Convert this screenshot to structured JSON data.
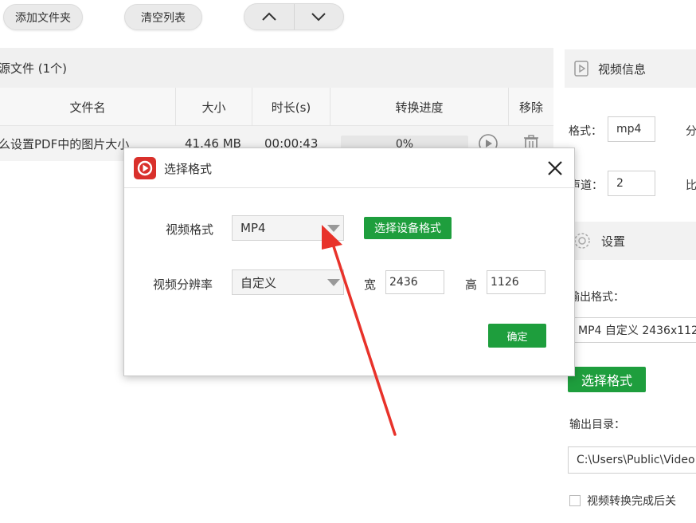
{
  "toolbar": {
    "add_folder_label": "添加文件夹",
    "clear_list_label": "清空列表",
    "up_icon": "chevron-up-icon",
    "down_icon": "chevron-down-icon"
  },
  "file_panel": {
    "source_header": "源文件 (1个)",
    "columns": [
      "文件名",
      "大小",
      "时长(s)",
      "转换进度",
      "移除"
    ],
    "rows": [
      {
        "name": "么设置PDF中的图片大小",
        "size": "41.46 MB",
        "duration": "00:00:43",
        "progress": "0%",
        "progress_value": 0
      }
    ]
  },
  "right_panel": {
    "video_info_title": "视频信息",
    "format_label": "格式：",
    "format_value": "mp4",
    "partial_label_1": "分",
    "channel_label": "声道：",
    "channel_value": "2",
    "partial_label_2": "比",
    "settings_title": "设置",
    "output_format_label": "输出格式：",
    "output_format_value": "MP4 自定义 2436x112",
    "choose_format_label": "选择格式",
    "output_dir_label": "输出目录：",
    "output_dir_value": "C:\\Users\\Public\\Video",
    "after_convert_label": "视频转换完成后关"
  },
  "dialog": {
    "title": "选择格式",
    "video_format_label": "视频格式",
    "video_format_value": "MP4",
    "device_format_button": "选择设备格式",
    "resolution_label": "视频分辨率",
    "resolution_value": "自定义",
    "width_label": "宽",
    "width_value": "2436",
    "height_label": "高",
    "height_value": "1126",
    "confirm_label": "确定"
  },
  "colors": {
    "accent_green": "#1e9e3d",
    "annotation_red": "#e8322a",
    "app_icon_red": "#d9302b"
  }
}
